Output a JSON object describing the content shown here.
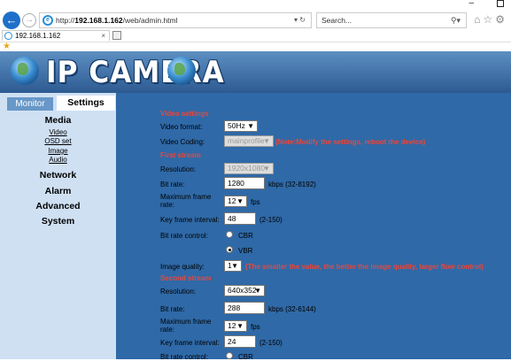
{
  "browser": {
    "address_prefix": "http://",
    "address_host": "192.168.1.162",
    "address_path": "/web/admin.html",
    "address_controls": "▾ ↻",
    "search_placeholder": "Search...",
    "tab_title": "192.168.1.162"
  },
  "banner": {
    "logo_text": "IP CAMERA"
  },
  "sidebar": {
    "tabs": [
      {
        "label": "Monitor",
        "active": false
      },
      {
        "label": "Settings",
        "active": true
      }
    ],
    "menu": {
      "media": "Media",
      "media_items": [
        "Video",
        "OSD set",
        "Image",
        "Audio"
      ],
      "network": "Network",
      "alarm": "Alarm",
      "advanced": "Advanced",
      "system": "System"
    }
  },
  "video": {
    "section_title": "Video settings",
    "format_label": "Video format:",
    "format_value": "50Hz",
    "coding_label": "Video Coding:",
    "coding_value": "mainprofile",
    "coding_note": "(Note:Modify the settings, reboot the device)",
    "first": {
      "title": "First stream",
      "resolution_label": "Resolution:",
      "resolution_value": "1920x1080",
      "bitrate_label": "Bit rate:",
      "bitrate_value": "1280",
      "bitrate_unit": "kbps (32-8192)",
      "framerate_label": "Maximum frame rate:",
      "framerate_value": "12",
      "framerate_unit": "fps",
      "keyframe_label": "Key frame interval:",
      "keyframe_value": "48",
      "keyframe_range": "(2-150)",
      "control_label": "Bit rate control:",
      "cbr_label": "CBR",
      "vbr_label": "VBR",
      "selected_control": "VBR",
      "quality_label": "Image quality:",
      "quality_value": "1",
      "quality_note": "(The smaller the value, the better the image quality, larger flow control)"
    },
    "second": {
      "title": "Second stream",
      "resolution_label": "Resolution:",
      "resolution_value": "640x352",
      "bitrate_label": "Bit rate:",
      "bitrate_value": "288",
      "bitrate_unit": "kbps (32-6144)",
      "framerate_label": "Maximum frame rate:",
      "framerate_value": "12",
      "framerate_unit": "fps",
      "keyframe_label": "Key frame interval:",
      "keyframe_value": "24",
      "keyframe_range": "(2-150)",
      "control_label": "Bit rate control:",
      "cbr_label": "CBR"
    }
  },
  "colors": {
    "banner": "#2c5a91",
    "sidebar": "#cfe0f3",
    "main": "#2f69a7",
    "section": "#e8473c"
  }
}
